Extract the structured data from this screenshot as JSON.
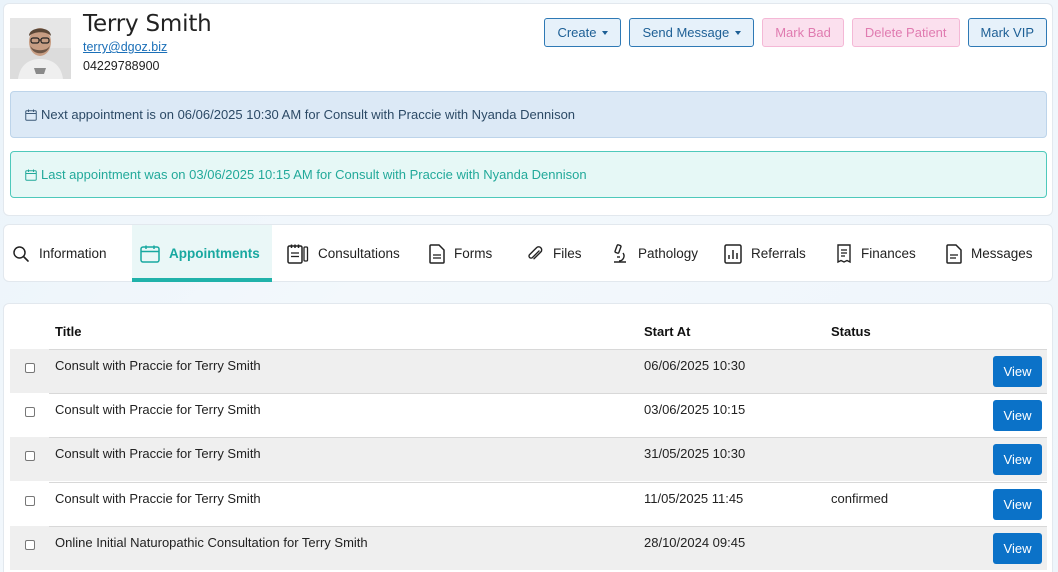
{
  "patient": {
    "name": "Terry Smith",
    "email": "terry@dgoz.biz",
    "phone": "04229788900"
  },
  "actions": {
    "create": "Create",
    "send_message": "Send Message",
    "mark_bad": "Mark Bad",
    "delete_patient": "Delete Patient",
    "mark_vip": "Mark VIP"
  },
  "alerts": {
    "next": "Next appointment is on 06/06/2025 10:30 AM for Consult with Praccie with Nyanda Dennison",
    "last": "Last appointment was on 03/06/2025 10:15 AM for Consult with Praccie with Nyanda Dennison"
  },
  "tabs": [
    {
      "label": "Information",
      "icon": "search-icon"
    },
    {
      "label": "Appointments",
      "icon": "calendar-icon"
    },
    {
      "label": "Consultations",
      "icon": "notebook-icon"
    },
    {
      "label": "Forms",
      "icon": "form-icon"
    },
    {
      "label": "Files",
      "icon": "paperclip-icon"
    },
    {
      "label": "Pathology",
      "icon": "microscope-icon"
    },
    {
      "label": "Referrals",
      "icon": "chart-doc-icon"
    },
    {
      "label": "Finances",
      "icon": "receipt-icon"
    },
    {
      "label": "Messages",
      "icon": "message-doc-icon"
    }
  ],
  "active_tab": "Appointments",
  "table": {
    "headers": {
      "title": "Title",
      "start": "Start At",
      "status": "Status"
    },
    "view_label": "View",
    "rows": [
      {
        "title": "Consult with Praccie for Terry Smith",
        "start": "06/06/2025 10:30",
        "status": ""
      },
      {
        "title": "Consult with Praccie for Terry Smith",
        "start": "03/06/2025 10:15",
        "status": ""
      },
      {
        "title": "Consult with Praccie for Terry Smith",
        "start": "31/05/2025 10:30",
        "status": ""
      },
      {
        "title": "Consult with Praccie for Terry Smith",
        "start": "11/05/2025 11:45",
        "status": "confirmed"
      },
      {
        "title": "Online Initial Naturopathic Consultation for Terry Smith",
        "start": "28/10/2024 09:45",
        "status": ""
      }
    ]
  },
  "colors": {
    "accent_teal": "#20b2aa",
    "primary_blue": "#0b72c8",
    "pink": "#fbe0ee"
  }
}
